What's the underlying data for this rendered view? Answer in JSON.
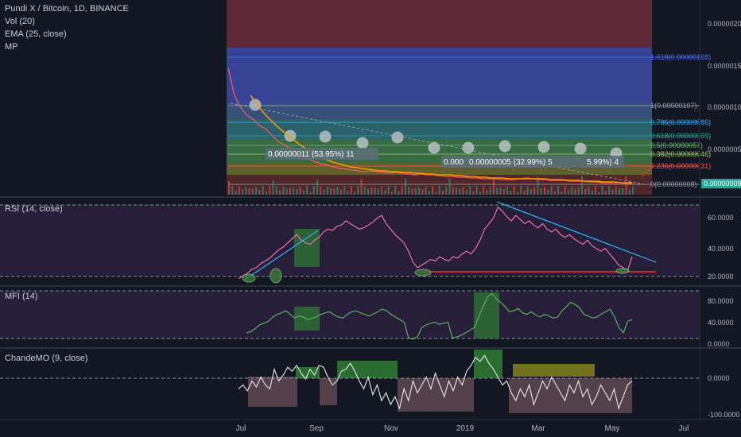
{
  "header": {
    "title": "Pundi X / Bitcoin, 1D, BINANCE",
    "lines": [
      "Vol (20)",
      "EMA (25, close)",
      "MP"
    ]
  },
  "colors": {
    "background": "#131722",
    "price_line": "#ff5a5a",
    "ema_line": "#ff9800",
    "rsi_line": "#f06fb0",
    "mfi_line": "#58b35a",
    "cmo_line": "#e8e8e8",
    "trend_blue": "#29b6f6",
    "trend_red": "#ff2e2e",
    "highlight_green": "#2e7d32",
    "highlight_olive": "#8a8a20"
  },
  "chart_data": [
    {
      "type": "line",
      "name": "price",
      "title": "Pundi X / Bitcoin, 1D, BINANCE",
      "x_ticks": [
        "Jul",
        "Sep",
        "Nov",
        "2019",
        "Mar",
        "May",
        "Jul"
      ],
      "y_ticks": [
        "0.00000200",
        "0.00000150",
        "0.00000100",
        "0.00000050"
      ],
      "current_value": "0.00000009",
      "fib_levels": [
        {
          "label": "1.618(0.00000168)",
          "value": 1.68
        },
        {
          "label": "1(0.00000107)",
          "value": 1.07
        },
        {
          "label": "0.786(0.00000086)",
          "value": 0.86
        },
        {
          "label": "0.618(0.00000069)",
          "value": 0.69
        },
        {
          "label": "0.5(0.00000057)",
          "value": 0.57
        },
        {
          "label": "0.382(0.00000046)",
          "value": 0.46
        },
        {
          "label": "0.236(0.00000031)",
          "value": 0.31
        },
        {
          "label": "0(0.00000008)",
          "value": 0.08
        }
      ],
      "annotations": [
        "0.00000011 (53.95%) 11",
        "0.000",
        "0.00000005 (32.99%) 5",
        "5.99%) 4"
      ],
      "unit_note": "values x 1e-6",
      "ylim": [
        0,
        2.2
      ],
      "values": [
        1.55,
        1.2,
        1.05,
        0.95,
        0.9,
        0.82,
        0.78,
        0.7,
        0.62,
        0.58,
        0.52,
        0.46,
        0.42,
        0.4,
        0.36,
        0.34,
        0.32,
        0.3,
        0.28,
        0.27,
        0.26,
        0.25,
        0.24,
        0.25,
        0.24,
        0.23,
        0.22,
        0.23,
        0.22,
        0.21,
        0.2,
        0.21,
        0.2,
        0.2,
        0.19,
        0.18,
        0.18,
        0.17,
        0.17,
        0.16,
        0.16,
        0.15,
        0.15,
        0.15,
        0.14,
        0.14,
        0.14,
        0.15,
        0.16,
        0.15,
        0.14,
        0.14,
        0.13,
        0.13,
        0.13,
        0.12,
        0.12,
        0.12,
        0.11,
        0.11,
        0.1,
        0.1,
        0.1,
        0.1,
        0.09,
        0.09
      ],
      "ema": [
        1.2,
        1.1,
        1.0,
        0.92,
        0.85,
        0.78,
        0.72,
        0.66,
        0.6,
        0.55,
        0.5,
        0.46,
        0.42,
        0.39,
        0.36,
        0.34,
        0.32,
        0.3,
        0.29,
        0.28,
        0.27,
        0.26,
        0.25,
        0.25,
        0.24,
        0.24,
        0.23,
        0.23,
        0.22,
        0.22,
        0.21,
        0.21,
        0.2,
        0.2,
        0.2,
        0.19,
        0.19,
        0.18,
        0.18,
        0.17,
        0.17,
        0.16,
        0.16,
        0.16,
        0.15,
        0.15,
        0.15,
        0.15,
        0.15,
        0.15,
        0.15,
        0.14,
        0.14,
        0.14,
        0.13,
        0.13,
        0.13,
        0.12,
        0.12,
        0.12,
        0.11,
        0.11,
        0.11,
        0.1,
        0.1,
        0.1
      ]
    },
    {
      "type": "line",
      "name": "RSI (14, close)",
      "title": "RSI (14, close)",
      "y_ticks": [
        "60.0000",
        "40.0000",
        "20.0000"
      ],
      "ylim": [
        15,
        75
      ],
      "values": [
        18,
        20,
        22,
        25,
        26,
        29,
        31,
        33,
        36,
        39,
        41,
        44,
        47,
        50,
        46,
        44,
        43,
        46,
        48,
        52,
        54,
        53,
        56,
        57,
        60,
        58,
        56,
        54,
        55,
        57,
        59,
        62,
        64,
        58,
        54,
        50,
        47,
        44,
        38,
        30,
        26,
        28,
        30,
        32,
        31,
        34,
        32,
        31,
        34,
        33,
        36,
        38,
        36,
        40,
        46,
        54,
        58,
        62,
        70,
        67,
        63,
        60,
        64,
        61,
        58,
        60,
        57,
        55,
        58,
        54,
        52,
        54,
        50,
        48,
        50,
        47,
        45,
        43,
        46,
        42,
        40,
        38,
        40,
        36,
        32,
        28,
        26,
        24,
        34
      ]
    },
    {
      "type": "line",
      "name": "MFI (14)",
      "title": "MFI (14)",
      "y_ticks": [
        "80.0000",
        "40.0000",
        "0.0000"
      ],
      "ylim": [
        0,
        100
      ],
      "values": [
        20,
        22,
        28,
        35,
        38,
        42,
        50,
        55,
        58,
        62,
        55,
        48,
        52,
        50,
        45,
        48,
        50,
        55,
        58,
        60,
        54,
        50,
        48,
        55,
        60,
        62,
        58,
        55,
        52,
        56,
        60,
        65,
        62,
        55,
        50,
        45,
        40,
        10,
        8,
        12,
        30,
        35,
        38,
        40,
        36,
        38,
        40,
        10,
        12,
        15,
        20,
        25,
        30,
        50,
        70,
        88,
        95,
        85,
        78,
        70,
        60,
        62,
        66,
        58,
        55,
        60,
        54,
        50,
        55,
        52,
        48,
        50,
        62,
        70,
        78,
        74,
        68,
        55,
        52,
        48,
        50,
        56,
        60,
        65,
        50,
        30,
        20,
        42,
        45
      ]
    },
    {
      "type": "line",
      "name": "ChandeMO (9, close)",
      "title": "ChandeMO (9, close)",
      "y_ticks": [
        "0.0000",
        "-100.0000"
      ],
      "ylim": [
        -110,
        60
      ],
      "values": [
        -40,
        -30,
        -45,
        -20,
        -35,
        -10,
        -30,
        -40,
        10,
        -20,
        -5,
        15,
        5,
        20,
        0,
        -15,
        10,
        -5,
        20,
        15,
        -10,
        -30,
        -20,
        5,
        10,
        25,
        5,
        -20,
        -40,
        -10,
        -55,
        -30,
        -70,
        -50,
        -80,
        -60,
        -90,
        -40,
        -70,
        -20,
        -50,
        -30,
        -10,
        -40,
        0,
        -30,
        -60,
        -20,
        -45,
        -10,
        -30,
        5,
        20,
        40,
        30,
        45,
        25,
        10,
        -10,
        -30,
        -20,
        -50,
        -70,
        -40,
        -60,
        -30,
        -80,
        -50,
        -20,
        -40,
        -10,
        -30,
        -50,
        -70,
        -30,
        -50,
        -20,
        -60,
        -40,
        -80,
        -60,
        -30,
        -50,
        -70,
        -40,
        -90,
        -60,
        -30,
        -20
      ]
    }
  ]
}
